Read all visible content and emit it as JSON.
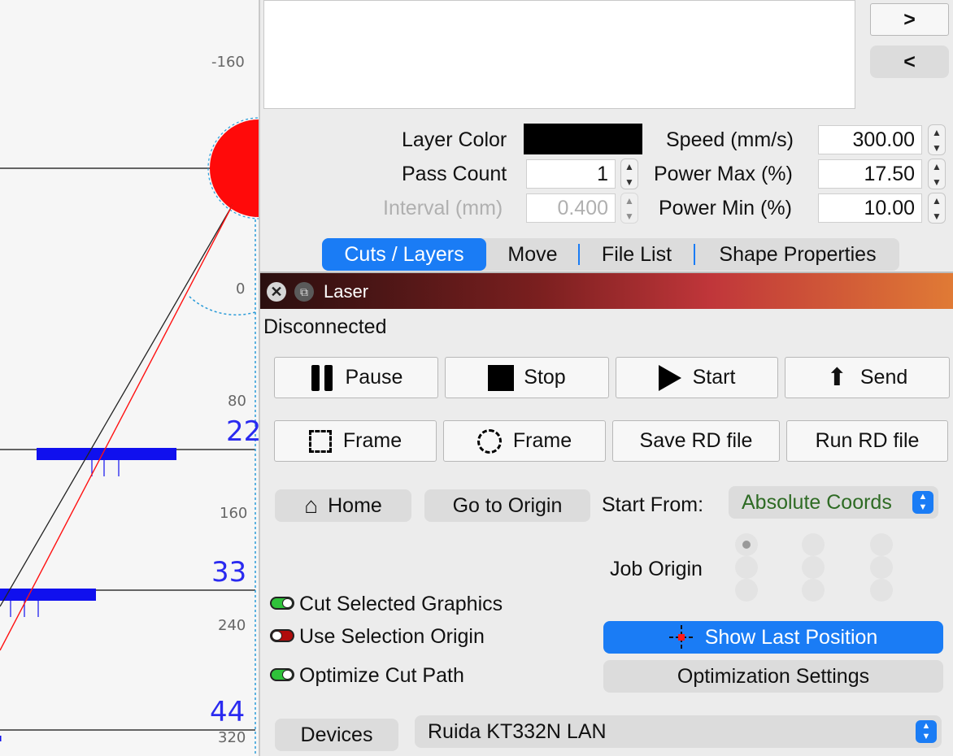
{
  "canvas": {
    "ruler_labels": [
      "-160",
      "0",
      "80",
      "160",
      "240",
      "320"
    ],
    "cut_numbers": [
      "22",
      "33",
      "44"
    ]
  },
  "nav": {
    "next_label": ">",
    "prev_label": "<"
  },
  "layer_settings": {
    "layer_color_label": "Layer Color",
    "layer_color": "#000000",
    "pass_count_label": "Pass Count",
    "pass_count_value": "1",
    "interval_label": "Interval (mm)",
    "interval_value": "0.400",
    "speed_label": "Speed (mm/s)",
    "speed_value": "300.00",
    "power_max_label": "Power Max (%)",
    "power_max_value": "17.50",
    "power_min_label": "Power Min (%)",
    "power_min_value": "10.00"
  },
  "tabs": [
    {
      "label": "Cuts / Layers",
      "active": true
    },
    {
      "label": "Move"
    },
    {
      "label": "File List"
    },
    {
      "label": "Shape Properties"
    }
  ],
  "laser": {
    "title": "Laser",
    "status": "Disconnected",
    "pause_label": "Pause",
    "stop_label": "Stop",
    "start_label": "Start",
    "send_label": "Send",
    "frame_rect_label": "Frame",
    "frame_circle_label": "Frame",
    "save_rd_label": "Save RD file",
    "run_rd_label": "Run RD file",
    "home_label": "Home",
    "go_origin_label": "Go to Origin",
    "start_from_label": "Start From:",
    "start_from_value": "Absolute Coords",
    "job_origin_label": "Job Origin",
    "cut_selected_label": "Cut Selected Graphics",
    "cut_selected_on": true,
    "use_selection_origin_label": "Use Selection Origin",
    "use_selection_origin_on": false,
    "optimize_cut_path_label": "Optimize Cut Path",
    "optimize_cut_path_on": true,
    "show_last_position_label": "Show Last Position",
    "optimization_settings_label": "Optimization Settings",
    "devices_label": "Devices",
    "device_value": "Ruida KT332N LAN"
  },
  "colors": {
    "accent": "#1a7cf5",
    "title_gradient_start": "#2a0f0f",
    "title_gradient_mid": "#c0363a",
    "title_gradient_end": "#e07a35",
    "toggle_on": "#2fc23a",
    "toggle_off": "#b00c0c",
    "start_from_text": "#2e6b24"
  }
}
